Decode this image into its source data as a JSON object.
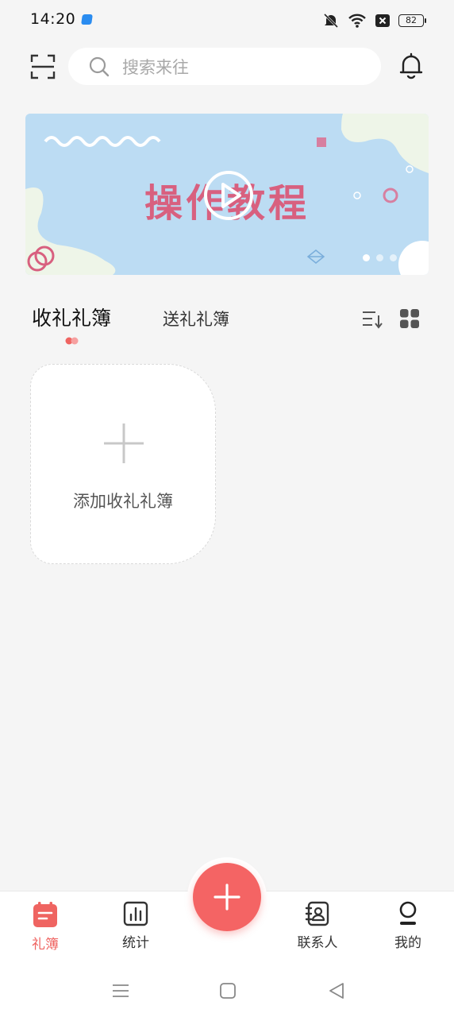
{
  "status": {
    "time": "14:20",
    "battery": "82"
  },
  "search": {
    "placeholder": "搜索来往"
  },
  "banner": {
    "title": "操作教程"
  },
  "tabs": [
    {
      "label": "收礼礼簿"
    },
    {
      "label": "送礼礼簿"
    }
  ],
  "add_card": {
    "label": "添加收礼礼簿"
  },
  "bottom_nav": [
    {
      "label": "礼簿",
      "icon": "gift-book-icon"
    },
    {
      "label": "统计",
      "icon": "stats-icon"
    },
    {
      "label": "联系人",
      "icon": "contacts-icon"
    },
    {
      "label": "我的",
      "icon": "profile-icon"
    }
  ],
  "colors": {
    "accent": "#ef6461",
    "banner_bg": "#bcdcf3",
    "banner_title": "#d8607f"
  }
}
